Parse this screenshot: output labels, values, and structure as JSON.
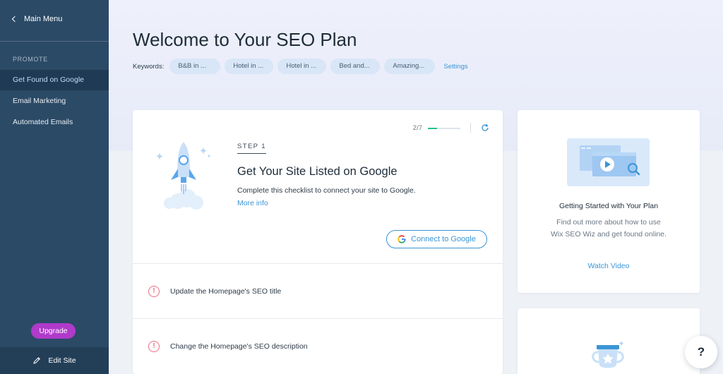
{
  "sidebar": {
    "main_menu": "Main Menu",
    "section": "PROMOTE",
    "items": [
      {
        "label": "Get Found on Google"
      },
      {
        "label": "Email Marketing"
      },
      {
        "label": "Automated Emails"
      }
    ],
    "upgrade": "Upgrade",
    "edit_site": "Edit Site"
  },
  "header": {
    "title": "Welcome to Your SEO Plan",
    "keywords_label": "Keywords:",
    "keywords": [
      "B&B in ...",
      "Hotel in ...",
      "Hotel in ...",
      "Bed and...",
      "Amazing..."
    ],
    "settings": "Settings"
  },
  "step": {
    "progress": "2/7",
    "progress_fraction": 0.2857,
    "label": "STEP 1",
    "title": "Get Your Site Listed on Google",
    "description": "Complete this checklist to connect your site to Google.",
    "more_info": "More info",
    "connect_button": "Connect to Google",
    "tasks": [
      {
        "label": "Update the Homepage's SEO title"
      },
      {
        "label": "Change the Homepage's SEO description"
      }
    ]
  },
  "video_card": {
    "title": "Getting Started with Your Plan",
    "desc_line1": "Find out more about how to use",
    "desc_line2": "Wix SEO Wiz and get found online.",
    "watch": "Watch Video"
  },
  "help": "?",
  "colors": {
    "sidebar": "#2b4a66",
    "accent": "#3a95d6",
    "upgrade": "#b03aca",
    "progress": "#22c48a",
    "warning": "#f06a7e"
  }
}
